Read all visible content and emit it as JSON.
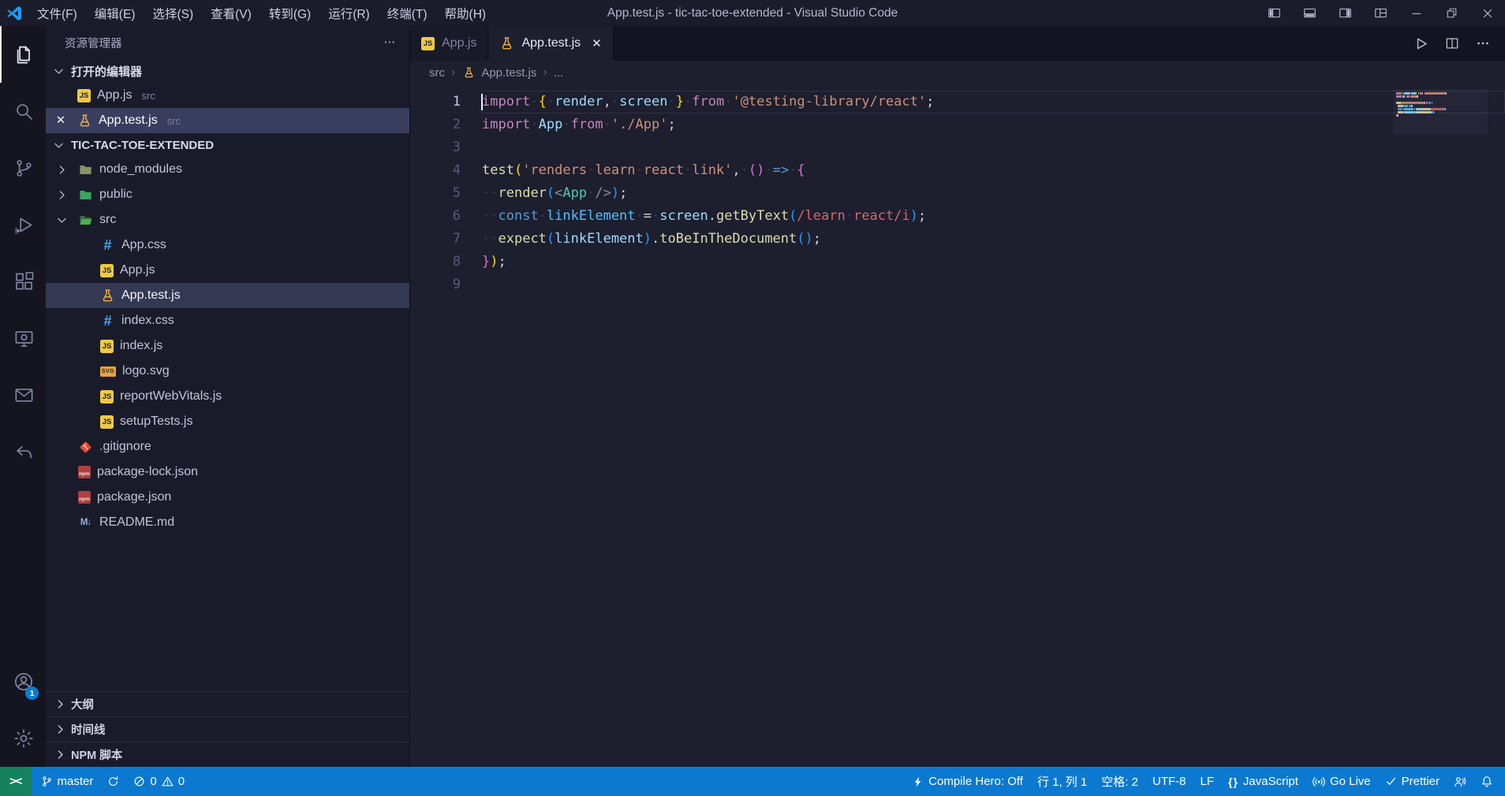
{
  "colors": {
    "statusbar": "#0b79d0",
    "remote_badge": "#16825d",
    "accent": "#0a7bd4",
    "titlebar": "#1b1c2b",
    "activitybar": "#14151f",
    "sidebar": "#1a1b2a",
    "editor": "#1d1e2e"
  },
  "title_bar": {
    "menus": [
      "文件(F)",
      "编辑(E)",
      "选择(S)",
      "查看(V)",
      "转到(G)",
      "运行(R)",
      "终端(T)",
      "帮助(H)"
    ],
    "title": "App.test.js - tic-tac-toe-extended - Visual Studio Code",
    "window_controls": [
      "layout-sidebar-left",
      "layout-panel",
      "layout-sidebar-right",
      "layout-grid",
      "minimize",
      "restore",
      "close"
    ]
  },
  "activity_bar": {
    "top": [
      {
        "name": "explorer",
        "active": true
      },
      {
        "name": "search"
      },
      {
        "name": "source-control"
      },
      {
        "name": "run-debug"
      },
      {
        "name": "extensions"
      },
      {
        "name": "remote-explorer"
      },
      {
        "name": "mail"
      },
      {
        "name": "reply"
      }
    ],
    "bottom": [
      {
        "name": "account",
        "badge": "1"
      },
      {
        "name": "settings"
      }
    ]
  },
  "sidebar": {
    "title": "资源管理器",
    "more_glyph": "⋯",
    "open_editors_label": "打开的编辑器",
    "open_editors": [
      {
        "label": "App.js",
        "desc": "src",
        "icon": "js",
        "active": false
      },
      {
        "label": "App.test.js",
        "desc": "src",
        "icon": "test",
        "active": true,
        "close_glyph": "✕"
      }
    ],
    "project_label": "TIC-TAC-TOE-EXTENDED",
    "tree": [
      {
        "label": "node_modules",
        "icon": "folder-node",
        "chevron": "right",
        "level": 0
      },
      {
        "label": "public",
        "icon": "folder-public",
        "chevron": "right",
        "level": 0
      },
      {
        "label": "src",
        "icon": "folder-src-open",
        "chevron": "down",
        "level": 0
      },
      {
        "label": "App.css",
        "icon": "css",
        "level": 1
      },
      {
        "label": "App.js",
        "icon": "js",
        "level": 1
      },
      {
        "label": "App.test.js",
        "icon": "test",
        "level": 1,
        "selected": true
      },
      {
        "label": "index.css",
        "icon": "css",
        "level": 1
      },
      {
        "label": "index.js",
        "icon": "js",
        "level": 1
      },
      {
        "label": "logo.svg",
        "icon": "svg",
        "level": 1
      },
      {
        "label": "reportWebVitals.js",
        "icon": "js",
        "level": 1
      },
      {
        "label": "setupTests.js",
        "icon": "js",
        "level": 1
      },
      {
        "label": ".gitignore",
        "icon": "git",
        "level": 0
      },
      {
        "label": "package-lock.json",
        "icon": "npm",
        "level": 0
      },
      {
        "label": "package.json",
        "icon": "npm",
        "level": 0
      },
      {
        "label": "README.md",
        "icon": "md",
        "level": 0
      }
    ],
    "bottom_sections": [
      "大纲",
      "时间线",
      "NPM 脚本"
    ]
  },
  "editor": {
    "tabs": [
      {
        "label": "App.js",
        "icon": "js",
        "active": false
      },
      {
        "label": "App.test.js",
        "icon": "test",
        "active": true,
        "close_glyph": "✕"
      }
    ],
    "actions": [
      "run",
      "split-editor",
      "more"
    ],
    "breadcrumb": [
      {
        "label": "src"
      },
      {
        "label": "App.test.js",
        "icon": "test"
      },
      {
        "label": "..."
      }
    ],
    "active_line": 1,
    "cursor": {
      "line": 1,
      "col": 1
    },
    "code_lines": [
      [
        {
          "t": "import",
          "c": "kw"
        },
        {
          "t": " "
        },
        {
          "t": "{",
          "c": "b1"
        },
        {
          "t": " "
        },
        {
          "t": "render",
          "c": "var"
        },
        {
          "t": ",",
          "c": "fg"
        },
        {
          "t": " "
        },
        {
          "t": "screen",
          "c": "var"
        },
        {
          "t": " "
        },
        {
          "t": "}",
          "c": "b1"
        },
        {
          "t": " "
        },
        {
          "t": "from",
          "c": "kw"
        },
        {
          "t": " "
        },
        {
          "t": "'@testing-library/react'",
          "c": "str"
        },
        {
          "t": ";",
          "c": "fg"
        }
      ],
      [
        {
          "t": "import",
          "c": "kw"
        },
        {
          "t": " "
        },
        {
          "t": "App",
          "c": "var"
        },
        {
          "t": " "
        },
        {
          "t": "from",
          "c": "kw"
        },
        {
          "t": " "
        },
        {
          "t": "'./App'",
          "c": "str"
        },
        {
          "t": ";",
          "c": "fg"
        }
      ],
      [],
      [
        {
          "t": "test",
          "c": "fn"
        },
        {
          "t": "(",
          "c": "b1"
        },
        {
          "t": "'renders learn react link'",
          "c": "str"
        },
        {
          "t": ",",
          "c": "fg"
        },
        {
          "t": " "
        },
        {
          "t": "(",
          "c": "b2"
        },
        {
          "t": ")",
          "c": "b2"
        },
        {
          "t": " "
        },
        {
          "t": "=>",
          "c": "kwb"
        },
        {
          "t": " "
        },
        {
          "t": "{",
          "c": "b2"
        }
      ],
      [
        {
          "t": "  "
        },
        {
          "t": "render",
          "c": "fn"
        },
        {
          "t": "(",
          "c": "b3"
        },
        {
          "t": "<",
          "c": "tag"
        },
        {
          "t": "App",
          "c": "comp"
        },
        {
          "t": " "
        },
        {
          "t": "/>",
          "c": "tag"
        },
        {
          "t": ")",
          "c": "b3"
        },
        {
          "t": ";",
          "c": "fg"
        }
      ],
      [
        {
          "t": "  "
        },
        {
          "t": "const",
          "c": "kwb"
        },
        {
          "t": " "
        },
        {
          "t": "linkElement",
          "c": "varb"
        },
        {
          "t": " "
        },
        {
          "t": "=",
          "c": "fg"
        },
        {
          "t": " "
        },
        {
          "t": "screen",
          "c": "var"
        },
        {
          "t": ".",
          "c": "fg"
        },
        {
          "t": "getByText",
          "c": "fn"
        },
        {
          "t": "(",
          "c": "b3"
        },
        {
          "t": "/learn react/i",
          "c": "rgx"
        },
        {
          "t": ")",
          "c": "b3"
        },
        {
          "t": ";",
          "c": "fg"
        }
      ],
      [
        {
          "t": "  "
        },
        {
          "t": "expect",
          "c": "fn"
        },
        {
          "t": "(",
          "c": "b3"
        },
        {
          "t": "linkElement",
          "c": "var"
        },
        {
          "t": ")",
          "c": "b3"
        },
        {
          "t": ".",
          "c": "fg"
        },
        {
          "t": "toBeInTheDocument",
          "c": "fn"
        },
        {
          "t": "(",
          "c": "b3"
        },
        {
          "t": ")",
          "c": "b3"
        },
        {
          "t": ";",
          "c": "fg"
        }
      ],
      [
        {
          "t": "}",
          "c": "b2"
        },
        {
          "t": ")",
          "c": "b1"
        },
        {
          "t": ";",
          "c": "fg"
        }
      ],
      []
    ]
  },
  "status_bar": {
    "left": [
      {
        "name": "remote-indicator",
        "icon": "remote",
        "text": "><"
      },
      {
        "name": "git-branch",
        "icon": "git-branch",
        "text": "master"
      },
      {
        "name": "sync-changes",
        "icon": "sync",
        "text": ""
      },
      {
        "name": "problems",
        "parts": [
          {
            "icon": "error",
            "text": "0"
          },
          {
            "icon": "warning",
            "text": "0"
          }
        ]
      }
    ],
    "right": [
      {
        "name": "compile-hero",
        "icon": "zap",
        "text": "Compile Hero: Off"
      },
      {
        "name": "cursor-position",
        "text": "行 1, 列 1"
      },
      {
        "name": "indentation",
        "text": "空格: 2"
      },
      {
        "name": "encoding",
        "text": "UTF-8"
      },
      {
        "name": "eol",
        "text": "LF"
      },
      {
        "name": "language-mode",
        "icon": "braces",
        "text": "JavaScript"
      },
      {
        "name": "go-live",
        "icon": "broadcast",
        "text": "Go Live"
      },
      {
        "name": "prettier",
        "icon": "check",
        "text": "Prettier"
      },
      {
        "name": "feedback",
        "icon": "feedback",
        "text": ""
      },
      {
        "name": "notifications",
        "icon": "bell",
        "text": ""
      }
    ]
  }
}
